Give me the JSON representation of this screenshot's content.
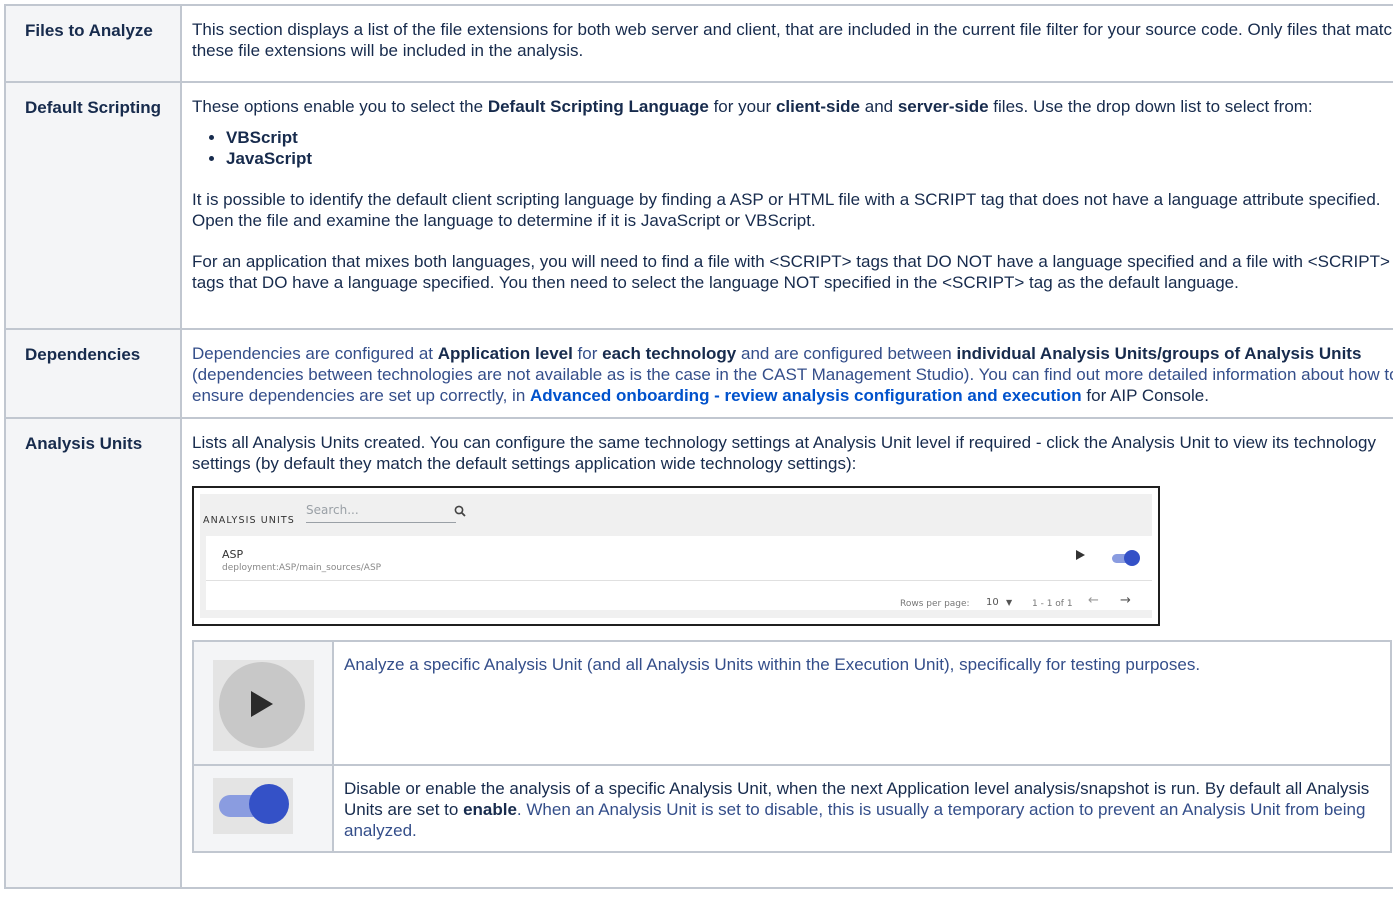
{
  "rows": {
    "files": {
      "heading": "Files to Analyze",
      "text": "This section displays a list of the file extensions for both web server and client, that are included in the current file filter for your source code. Only files that match these file extensions will be included in the analysis."
    },
    "scripting": {
      "heading": "Default Scripting",
      "intro_1": "These options enable you to select the ",
      "intro_b1": "Default Scripting Language",
      "intro_2": " for your ",
      "intro_b2": "client-side",
      "intro_3": " and ",
      "intro_b3": "server-side",
      "intro_4": " files. Use the drop down list to select from:",
      "options": [
        "VBScript",
        "JavaScript"
      ],
      "para_2": "It is possible to identify the default client scripting language by finding a ASP or HTML file with a SCRIPT tag that does not have a language attribute specified. Open the file and examine the language to determine if it is JavaScript or VBScript.",
      "para_3": "For an application that mixes both languages, you will need to find a file with <SCRIPT> tags that DO NOT have a language specified and a file with <SCRIPT> tags that DO have a language specified. You then need to select the language NOT specified in the <SCRIPT> tag as the default language."
    },
    "dependencies": {
      "heading": "Dependencies",
      "t1": "Dependencies are configured at ",
      "b1": "Application level",
      "t2": " for ",
      "b2": "each technology",
      "t3": " and are configured between ",
      "b3": "individual Analysis Units/groups of Analysis Units",
      "t4": " (dependencies between technologies are not available as is the case in the CAST Management Studio). You can find out more detailed information about how to ensure dependencies are set up correctly, in ",
      "link": "Advanced onboarding - review analysis configuration and execution",
      "t5": " for AIP Console."
    },
    "analysis_units": {
      "heading": "Analysis Units",
      "text": "Lists all Analysis Units created. You can configure the same technology settings at Analysis Unit level if required - click the Analysis Unit to view its technology settings (by default they match the default settings application wide technology settings):",
      "screenshot": {
        "title": "ANALYSIS UNITS",
        "search_placeholder": "Search...",
        "unit_name": "ASP",
        "unit_path": "deployment:ASP/main_sources/ASP",
        "unit_enabled": true,
        "rows_per_page_label": "Rows per page:",
        "rows_per_page_value": "10",
        "range": "1 - 1 of 1"
      },
      "icon_rows": [
        {
          "icon": "play-icon",
          "text": "Analyze a specific Analysis Unit (and all Analysis Units within the Execution Unit), specifically for testing purposes."
        },
        {
          "icon": "toggle-icon",
          "t1": "Disable or enable the analysis of a specific Analysis Unit, when the next Application level analysis/snapshot is run. By default all Analysis Units are set to ",
          "b1": "enable",
          "t2": ". When an Analysis Unit is set to disable, this is usually a temporary action to prevent an Analysis Unit from being analyzed."
        }
      ]
    }
  },
  "colors": {
    "header_bg": "#f4f5f7",
    "border": "#c1c7d0",
    "text": "#172b4d",
    "blue_text": "#344e8a",
    "link": "#0052cc",
    "toggle_knob": "#3451c7",
    "toggle_track": "#8a9ce0"
  }
}
